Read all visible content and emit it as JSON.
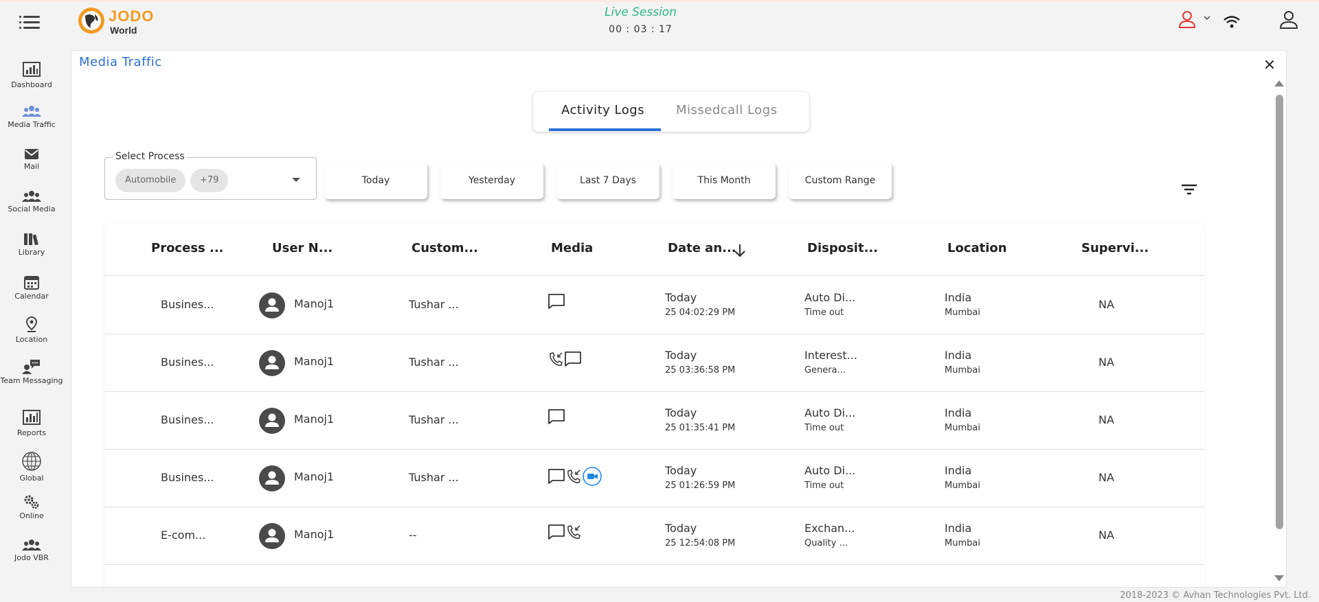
{
  "header": {
    "logo_title": "JODO",
    "logo_subtitle": "World",
    "session_label": "Live Session",
    "session_timer": "00 : 03 : 17"
  },
  "sidebar": {
    "items": [
      {
        "label": "Dashboard",
        "icon": "dashboard-icon"
      },
      {
        "label": "Media Traffic",
        "icon": "group-icon"
      },
      {
        "label": "Mail",
        "icon": "mail-icon"
      },
      {
        "label": "Social Media",
        "icon": "people-icon"
      },
      {
        "label": "Library",
        "icon": "library-icon"
      },
      {
        "label": "Calendar",
        "icon": "calendar-icon"
      },
      {
        "label": "Location",
        "icon": "location-pin-icon"
      },
      {
        "label": "Team Messaging",
        "icon": "team-chat-icon"
      },
      {
        "label": "Reports",
        "icon": "reports-icon"
      },
      {
        "label": "Global",
        "icon": "globe-icon"
      },
      {
        "label": "Online",
        "icon": "gears-icon"
      },
      {
        "label": "Jodo VBR",
        "icon": "group-icon"
      }
    ]
  },
  "main": {
    "title": "Media Traffic",
    "tabs": [
      {
        "label": "Activity Logs",
        "active": true
      },
      {
        "label": "Missedcall Logs",
        "active": false
      }
    ],
    "select_process": {
      "legend": "Select Process",
      "chips": [
        "Automobile",
        "+79"
      ]
    },
    "date_ranges": [
      "Today",
      "Yesterday",
      "Last 7 Days",
      "This Month",
      "Custom Range"
    ],
    "table": {
      "columns": [
        "Process ...",
        "User N...",
        "Custom...",
        "Media",
        "Date an...",
        "Disposit...",
        "Location",
        "Supervi..."
      ],
      "rows": [
        {
          "process": "Busines...",
          "user": "Manoj1",
          "customer": "Tushar ...",
          "media": [
            "chat"
          ],
          "date": "Today",
          "time": "25 04:02:29 PM",
          "disposition": "Auto Di...",
          "disposition_sub": "Time out",
          "location": "India",
          "location_sub": "Mumbai",
          "supervisor": "NA"
        },
        {
          "process": "Busines...",
          "user": "Manoj1",
          "customer": "Tushar ...",
          "media": [
            "call",
            "chat"
          ],
          "date": "Today",
          "time": "25 03:36:58 PM",
          "disposition": "Interest...",
          "disposition_sub": "Genera...",
          "location": "India",
          "location_sub": "Mumbai",
          "supervisor": "NA"
        },
        {
          "process": "Busines...",
          "user": "Manoj1",
          "customer": "Tushar ...",
          "media": [
            "chat"
          ],
          "date": "Today",
          "time": "25 01:35:41 PM",
          "disposition": "Auto Di...",
          "disposition_sub": "Time out",
          "location": "India",
          "location_sub": "Mumbai",
          "supervisor": "NA"
        },
        {
          "process": "Busines...",
          "user": "Manoj1",
          "customer": "Tushar ...",
          "media": [
            "chat",
            "call",
            "video"
          ],
          "date": "Today",
          "time": "25 01:26:59 PM",
          "disposition": "Auto Di...",
          "disposition_sub": "Time out",
          "location": "India",
          "location_sub": "Mumbai",
          "supervisor": "NA"
        },
        {
          "process": "E-com...",
          "user": "Manoj1",
          "customer": "--",
          "media": [
            "chat",
            "call"
          ],
          "date": "Today",
          "time": "25 12:54:08 PM",
          "disposition": "Exchan...",
          "disposition_sub": "Quality ...",
          "location": "India",
          "location_sub": "Mumbai",
          "supervisor": "NA"
        }
      ]
    }
  },
  "footer": {
    "copyright": "2018-2023 © Avhan Technologies Pvt. Ltd."
  },
  "colors": {
    "accent": "#2a6fd6",
    "live": "#2cb784",
    "logo_orange": "#f29a22",
    "user_red": "#e53935",
    "video_blue": "#1e88e5"
  }
}
